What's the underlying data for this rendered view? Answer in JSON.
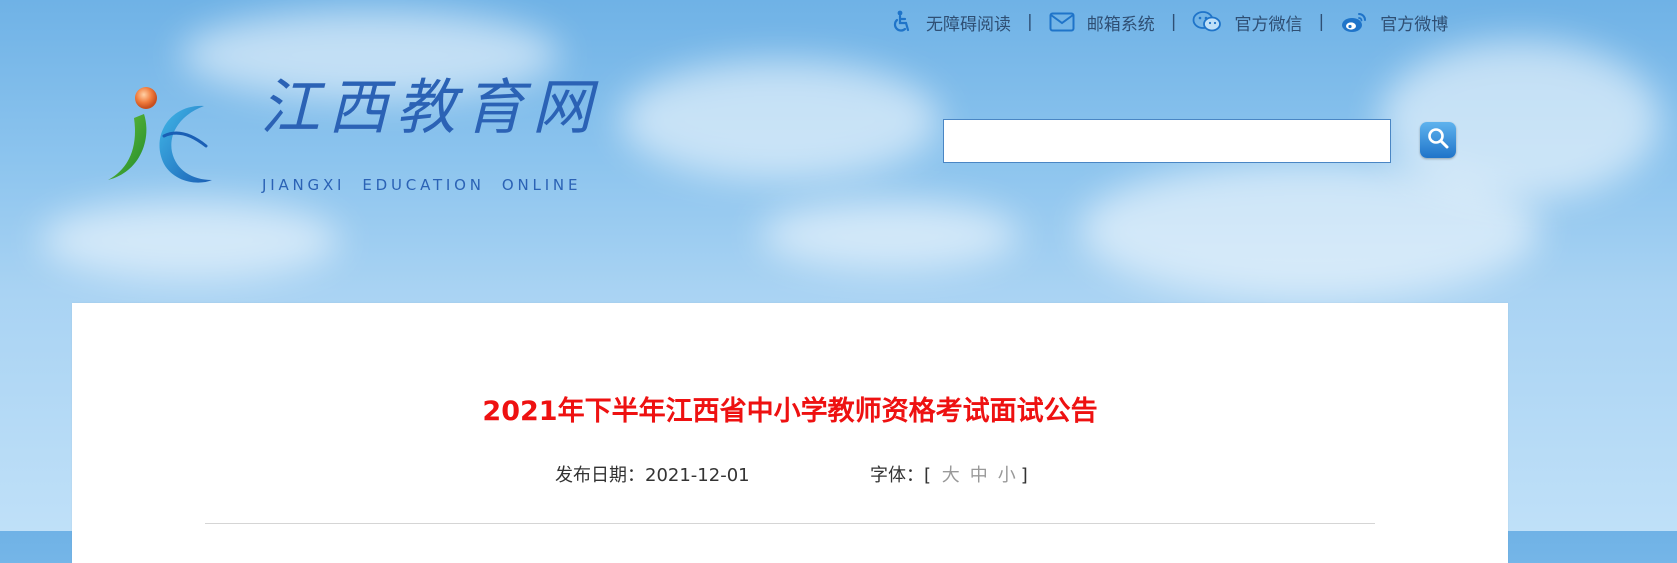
{
  "header": {
    "toplinks": [
      {
        "label": "无障碍阅读",
        "icon": "accessibility-icon"
      },
      {
        "label": "邮箱系统",
        "icon": "mail-icon"
      },
      {
        "label": "官方微信",
        "icon": "wechat-icon"
      },
      {
        "label": "官方微博",
        "icon": "weibo-icon"
      }
    ],
    "separator": "|",
    "logo": {
      "title": "江西教育网",
      "subtitle": "JIANGXI  EDUCATION  ONLINE"
    },
    "search": {
      "value": "",
      "placeholder": ""
    }
  },
  "article": {
    "title": "2021年下半年江西省中小学教师资格考试面试公告",
    "date_label": "发布日期：",
    "date": "2021-12-01",
    "font_label": "字体：",
    "bracket_open": "[",
    "bracket_close": "]",
    "font_sizes": [
      "大",
      "中",
      "小"
    ]
  },
  "colors": {
    "title_red": "#ee1111",
    "link_blue": "#2f4f74",
    "brand_blue": "#2b62b5",
    "icon_blue": "#1f74c9"
  }
}
